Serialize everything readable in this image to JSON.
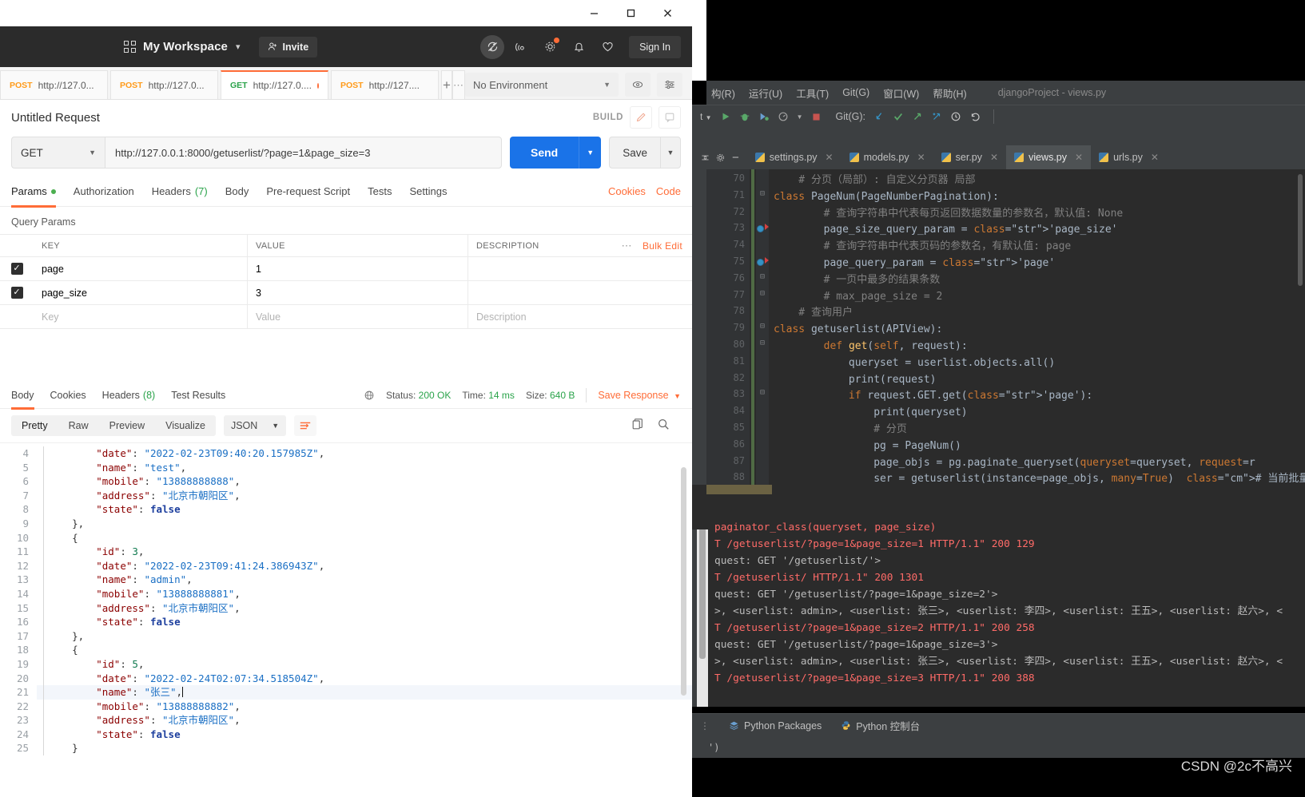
{
  "window": {
    "minimize": "minimize-icon",
    "maximize": "maximize-icon",
    "close": "close-icon"
  },
  "postman": {
    "header": {
      "workspace_icon": "grid-icon",
      "workspace_name": "My Workspace",
      "workspace_caret": "chevron-down-icon",
      "invite_label": "Invite",
      "invite_icon": "user-plus-icon",
      "icons": [
        {
          "name": "sync-off-icon",
          "badge": false
        },
        {
          "name": "satellite-icon",
          "badge": false
        },
        {
          "name": "gear-icon",
          "badge": true
        },
        {
          "name": "bell-icon",
          "badge": false
        },
        {
          "name": "heart-icon",
          "badge": false
        }
      ],
      "sign_in_label": "Sign In"
    },
    "tabs": [
      {
        "method": "POST",
        "url": "http://127.0...",
        "active": false,
        "unsaved": true
      },
      {
        "method": "POST",
        "url": "http://127.0...",
        "active": false,
        "unsaved": true
      },
      {
        "method": "GET",
        "url": "http://127.0....",
        "active": true,
        "unsaved": true
      },
      {
        "method": "POST",
        "url": "http://127....",
        "active": false,
        "unsaved": false
      }
    ],
    "tab_add_icon": "plus-icon",
    "tab_more_icon": "ellipsis-icon",
    "environment": {
      "selected": "No Environment",
      "caret": "chevron-down-icon",
      "eye_icon": "eye-icon",
      "settings_icon": "sliders-icon"
    },
    "request": {
      "title": "Untitled Request",
      "build_label": "BUILD",
      "edit_icon": "pencil-icon",
      "comment_icon": "comment-icon",
      "method": "GET",
      "method_caret": "chevron-down-icon",
      "url": "http://127.0.0.1:8000/getuserlist/?page=1&page_size=3",
      "send_label": "Send",
      "send_caret": "chevron-down-icon",
      "save_label": "Save",
      "save_caret": "chevron-down-icon",
      "tabs": [
        {
          "label": "Params",
          "badge": "dot",
          "active": true
        },
        {
          "label": "Authorization",
          "badge": "",
          "active": false
        },
        {
          "label": "Headers",
          "badge": "(7)",
          "active": false
        },
        {
          "label": "Body",
          "badge": "",
          "active": false
        },
        {
          "label": "Pre-request Script",
          "badge": "",
          "active": false
        },
        {
          "label": "Tests",
          "badge": "",
          "active": false
        },
        {
          "label": "Settings",
          "badge": "",
          "active": false
        }
      ],
      "cookies_link": "Cookies",
      "code_link": "Code"
    },
    "query_params": {
      "section_label": "Query Params",
      "columns": [
        "KEY",
        "VALUE",
        "DESCRIPTION"
      ],
      "more_icon": "ellipsis-icon",
      "bulk_edit_label": "Bulk Edit",
      "rows": [
        {
          "checked": true,
          "key": "page",
          "value": "1",
          "description": ""
        },
        {
          "checked": true,
          "key": "page_size",
          "value": "3",
          "description": ""
        }
      ],
      "placeholder_row": {
        "key": "Key",
        "value": "Value",
        "description": "Description"
      }
    },
    "response": {
      "tabs": [
        {
          "label": "Body",
          "badge": "",
          "active": true
        },
        {
          "label": "Cookies",
          "badge": "",
          "active": false
        },
        {
          "label": "Headers",
          "badge": "(8)",
          "active": false
        },
        {
          "label": "Test Results",
          "badge": "",
          "active": false
        }
      ],
      "globe_icon": "globe-icon",
      "status_label": "Status:",
      "status_value": "200 OK",
      "time_label": "Time:",
      "time_value": "14 ms",
      "size_label": "Size:",
      "size_value": "640 B",
      "save_response_label": "Save Response",
      "save_response_caret": "chevron-down-icon",
      "format_tabs": [
        "Pretty",
        "Raw",
        "Preview",
        "Visualize"
      ],
      "format_active": "Pretty",
      "format_type": "JSON",
      "format_type_caret": "chevron-down-icon",
      "wrap_icon": "word-wrap-icon",
      "copy_icon": "copy-icon",
      "search_icon": "search-icon",
      "body_lines": [
        {
          "num": 4,
          "text": "        \"date\": \"2022-02-23T09:40:20.157985Z\",",
          "hl": false
        },
        {
          "num": 5,
          "text": "        \"name\": \"test\",",
          "hl": false
        },
        {
          "num": 6,
          "text": "        \"mobile\": \"13888888888\",",
          "hl": false
        },
        {
          "num": 7,
          "text": "        \"address\": \"北京市朝阳区\",",
          "hl": false
        },
        {
          "num": 8,
          "text": "        \"state\": false",
          "hl": false
        },
        {
          "num": 9,
          "text": "    },",
          "hl": false
        },
        {
          "num": 10,
          "text": "    {",
          "hl": false
        },
        {
          "num": 11,
          "text": "        \"id\": 3,",
          "hl": false
        },
        {
          "num": 12,
          "text": "        \"date\": \"2022-02-23T09:41:24.386943Z\",",
          "hl": false
        },
        {
          "num": 13,
          "text": "        \"name\": \"admin\",",
          "hl": false
        },
        {
          "num": 14,
          "text": "        \"mobile\": \"13888888881\",",
          "hl": false
        },
        {
          "num": 15,
          "text": "        \"address\": \"北京市朝阳区\",",
          "hl": false
        },
        {
          "num": 16,
          "text": "        \"state\": false",
          "hl": false
        },
        {
          "num": 17,
          "text": "    },",
          "hl": false
        },
        {
          "num": 18,
          "text": "    {",
          "hl": false
        },
        {
          "num": 19,
          "text": "        \"id\": 5,",
          "hl": false
        },
        {
          "num": 20,
          "text": "        \"date\": \"2022-02-24T02:07:34.518504Z\",",
          "hl": false
        },
        {
          "num": 21,
          "text": "        \"name\": \"张三\",",
          "hl": true
        },
        {
          "num": 22,
          "text": "        \"mobile\": \"13888888882\",",
          "hl": false
        },
        {
          "num": 23,
          "text": "        \"address\": \"北京市朝阳区\",",
          "hl": false
        },
        {
          "num": 24,
          "text": "        \"state\": false",
          "hl": false
        },
        {
          "num": 25,
          "text": "    }",
          "hl": false
        }
      ]
    }
  },
  "pycharm": {
    "menu_items": [
      "构(R)",
      "运行(U)",
      "工具(T)",
      "Git(G)",
      "窗口(W)",
      "帮助(H)"
    ],
    "project_title": "djangoProject - views.py",
    "toolbar": {
      "run_config_caret": "chevron-down-icon",
      "run_icon": "run-icon",
      "debug_icon": "debug-icon",
      "coverage_icon": "coverage-icon",
      "profile_icon": "profile-icon",
      "stop_icon": "stop-icon",
      "git_label": "Git(G):",
      "update_icon": "update-project-icon",
      "commit_icon": "commit-check-icon",
      "push_icon": "push-arrow-icon",
      "branch_icon": "branch-icon",
      "history_icon": "history-clock-icon",
      "rollback_icon": "rollback-icon",
      "settings_icon": "gear-icon",
      "collapse_icon": "collapse-icon",
      "hide_icon": "minus-icon"
    },
    "editor_tabs": [
      {
        "label": "settings.py",
        "active": false
      },
      {
        "label": "models.py",
        "active": false
      },
      {
        "label": "ser.py",
        "active": false
      },
      {
        "label": "views.py",
        "active": true
      },
      {
        "label": "urls.py",
        "active": false
      }
    ],
    "code_lines": [
      {
        "num": 70,
        "text": "    # 分页（局部）: 自定义分页器 局部",
        "breakpoint": false
      },
      {
        "num": 71,
        "text": "class PageNum(PageNumberPagination):",
        "breakpoint": false
      },
      {
        "num": 72,
        "text": "        # 查询字符串中代表每页返回数据数量的参数名，默认值: None",
        "breakpoint": false
      },
      {
        "num": 73,
        "text": "        page_size_query_param = 'page_size'",
        "breakpoint": true
      },
      {
        "num": 74,
        "text": "        # 查询字符串中代表页码的参数名，有默认值: page",
        "breakpoint": false
      },
      {
        "num": 75,
        "text": "        page_query_param = 'page'",
        "breakpoint": true
      },
      {
        "num": 76,
        "text": "        # 一页中最多的结果条数",
        "breakpoint": false
      },
      {
        "num": 77,
        "text": "        # max_page_size = 2",
        "breakpoint": false
      },
      {
        "num": 78,
        "text": "    # 查询用户",
        "breakpoint": false
      },
      {
        "num": 79,
        "text": "class getuserlist(APIView):",
        "breakpoint": false
      },
      {
        "num": 80,
        "text": "        def get(self, request):",
        "breakpoint": false
      },
      {
        "num": 81,
        "text": "            queryset = userlist.objects.all()",
        "breakpoint": false
      },
      {
        "num": 82,
        "text": "            print(request)",
        "breakpoint": false
      },
      {
        "num": 83,
        "text": "            if request.GET.get('page'):",
        "breakpoint": false
      },
      {
        "num": 84,
        "text": "                print(queryset)",
        "breakpoint": false
      },
      {
        "num": 85,
        "text": "                # 分页",
        "breakpoint": false
      },
      {
        "num": 86,
        "text": "                pg = PageNum()",
        "breakpoint": false
      },
      {
        "num": 87,
        "text": "                page_objs = pg.paginate_queryset(queryset=queryset, request=r",
        "breakpoint": false
      },
      {
        "num": 88,
        "text": "                ser = getuserlist(instance=page_objs, many=True)  # 当前批量",
        "breakpoint": false
      }
    ],
    "console_lines": [
      {
        "text": "paginator_class(queryset, page_size)",
        "error": true
      },
      {
        "text": "T /getuserlist/?page=1&page_size=1 HTTP/1.1\" 200 129",
        "error": true
      },
      {
        "text": "quest: GET '/getuserlist/'>",
        "error": false
      },
      {
        "text": "T /getuserlist/ HTTP/1.1\" 200 1301",
        "error": true
      },
      {
        "text": "quest: GET '/getuserlist/?page=1&page_size=2'>",
        "error": false
      },
      {
        "text": ">, <userlist: admin>, <userlist: 张三>, <userlist: 李四>, <userlist: 王五>, <userlist: 赵六>, <",
        "error": false
      },
      {
        "text": "T /getuserlist/?page=1&page_size=2 HTTP/1.1\" 200 258",
        "error": true
      },
      {
        "text": "quest: GET '/getuserlist/?page=1&page_size=3'>",
        "error": false
      },
      {
        "text": ">, <userlist: admin>, <userlist: 张三>, <userlist: 李四>, <userlist: 王五>, <userlist: 赵六>, <",
        "error": false
      },
      {
        "text": "T /getuserlist/?page=1&page_size=3 HTTP/1.1\" 200 388",
        "error": true
      }
    ],
    "bottom_tabs": [
      {
        "label": "Python Packages",
        "icon": "packages-icon"
      },
      {
        "label": "Python 控制台",
        "icon": "python-console-icon"
      }
    ],
    "status_text": "')"
  },
  "watermark": "CSDN @2c不高兴",
  "colors": {
    "accent_orange": "#ff6c37",
    "send_blue": "#1a73e8",
    "success_green": "#2aa34a",
    "postman_header": "#2b2b2b",
    "ide_chrome": "#3c3f41",
    "ide_editor": "#2b2b2b",
    "console_error": "#ff6b68"
  }
}
